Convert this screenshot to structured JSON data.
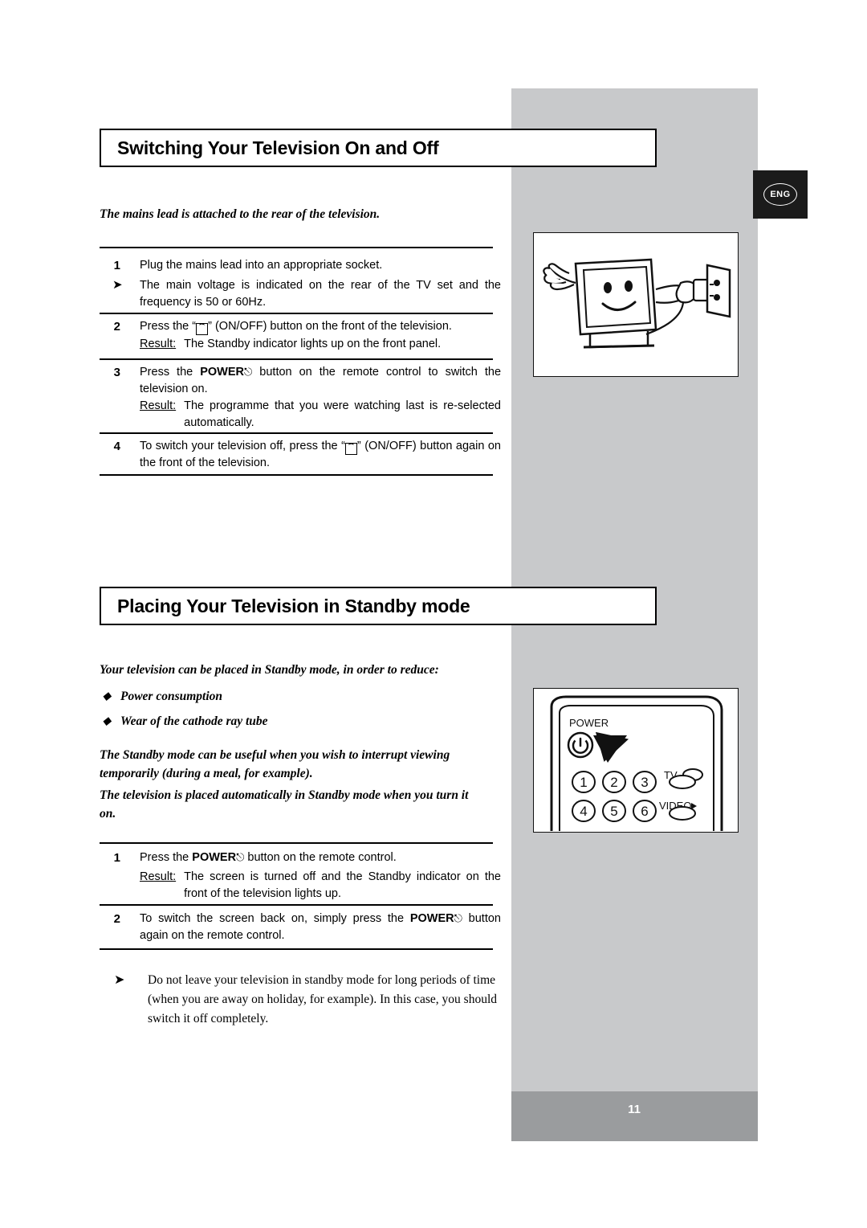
{
  "page": {
    "number": "11",
    "language_badge": "ENG"
  },
  "sections": [
    {
      "title": "Switching Your Television On and Off",
      "intro": "The mains lead is attached to the rear of the television.",
      "steps": [
        {
          "num": "1",
          "text": "Plug the mains lead into an appropriate socket.",
          "note_glyph": "➤",
          "note": "The main voltage is indicated on the rear of the TV set and the frequency is 50 or 60Hz."
        },
        {
          "num": "2",
          "text_pre": "Press the “",
          "text_post": "” (ON/OFF) button on the front of the television.",
          "result_label": "Result:",
          "result": "The Standby indicator lights up on the front panel."
        },
        {
          "num": "3",
          "text_pre": "Press the ",
          "power": "POWER",
          "text_post": " button on the remote control to switch the television on.",
          "result_label": "Result:",
          "result": "The programme that you were watching last is re-selected automatically."
        },
        {
          "num": "4",
          "text_pre": "To switch your television off, press the “",
          "text_post": "” (ON/OFF) button again on the front of the television."
        }
      ]
    },
    {
      "title": "Placing Your Television in Standby mode",
      "intro": "Your television can be placed in Standby mode, in order to reduce:",
      "bullets": [
        "Power consumption",
        "Wear of the cathode ray tube"
      ],
      "paragraph_1": "The Standby mode can be useful when you wish to interrupt viewing temporarily (during a meal, for example).",
      "paragraph_2": "The television is placed automatically in Standby mode when you turn it on.",
      "steps": [
        {
          "num": "1",
          "text_pre": "Press the ",
          "power": "POWER",
          "text_post": " button on the remote control.",
          "result_label": "Result:",
          "result": "The screen is turned off and the Standby indicator on the front of the television lights up."
        },
        {
          "num": "2",
          "text_pre": "To switch the screen back on, simply press the ",
          "power": "POWER",
          "text_post": " button again on the remote control."
        }
      ],
      "note": {
        "glyph": "➤",
        "text": "Do not leave your television in standby mode for long periods of time (when you are away on holiday, for example). In this case, you should switch it off completely."
      }
    }
  ],
  "illustrations": {
    "tv_plug": {
      "name": "cartoon-tv-plugging-into-wall-socket"
    },
    "remote": {
      "name": "remote-control-keypad",
      "power_label": "POWER",
      "tv_label": "TV",
      "video_label": "VIDEO",
      "keys": [
        "1",
        "2",
        "3",
        "4",
        "5",
        "6"
      ]
    }
  }
}
